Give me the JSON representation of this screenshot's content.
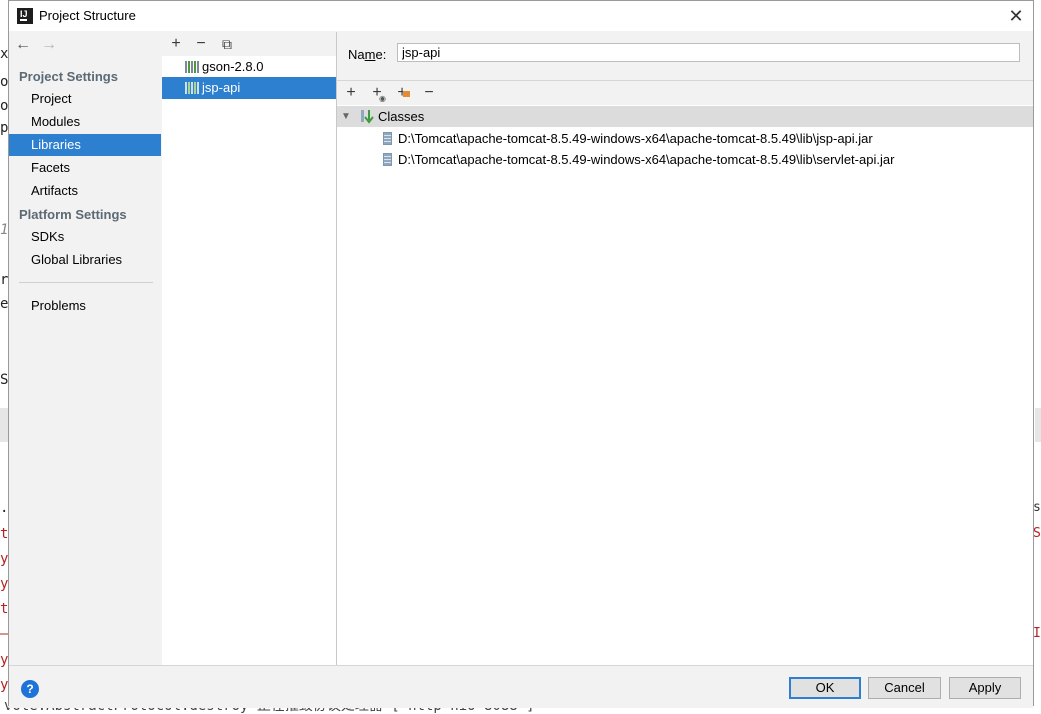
{
  "background": {
    "left_chars": [
      "x",
      "o",
      "o",
      "p",
      "1",
      "r",
      "e",
      "S",
      ".",
      "t",
      "y",
      "y",
      "t",
      "–",
      "y",
      "y"
    ],
    "bottom_text": "vote.AbstractProtocol.destroy 正在摧毁协议处理器 [\"http-nio-8088\"]",
    "right_chars": [
      "s",
      "S",
      "I"
    ]
  },
  "dialog": {
    "title": "Project Structure",
    "close": "✕",
    "nav": {
      "back": "←",
      "forward": "→",
      "section_project": "Project Settings",
      "project": "Project",
      "modules": "Modules",
      "libraries": "Libraries",
      "facets": "Facets",
      "artifacts": "Artifacts",
      "section_platform": "Platform Settings",
      "sdks": "SDKs",
      "global_libraries": "Global Libraries",
      "problems": "Problems"
    },
    "libraries_toolbar": {
      "add": "+",
      "remove": "−",
      "copy": "⧉"
    },
    "libraries": [
      {
        "name": "gson-2.8.0",
        "selected": false
      },
      {
        "name": "jsp-api",
        "selected": true
      }
    ],
    "detail": {
      "name_label_prefix": "Na",
      "name_label_mnemonic": "m",
      "name_label_suffix": "e:",
      "name_value": "jsp-api",
      "toolbar": {
        "add": "+",
        "add_special": "+",
        "add_alt": "+",
        "remove": "−"
      },
      "classes_label": "Classes",
      "jars": [
        "D:\\Tomcat\\apache-tomcat-8.5.49-windows-x64\\apache-tomcat-8.5.49\\lib\\jsp-api.jar",
        "D:\\Tomcat\\apache-tomcat-8.5.49-windows-x64\\apache-tomcat-8.5.49\\lib\\servlet-api.jar"
      ]
    },
    "footer": {
      "help": "?",
      "ok": "OK",
      "cancel": "Cancel",
      "apply": "Apply"
    }
  },
  "colors": {
    "selection": "#2d7fcf",
    "section_header": "#5b6a75",
    "panel": "#f2f2f2",
    "help_icon": "#1f73d8"
  }
}
